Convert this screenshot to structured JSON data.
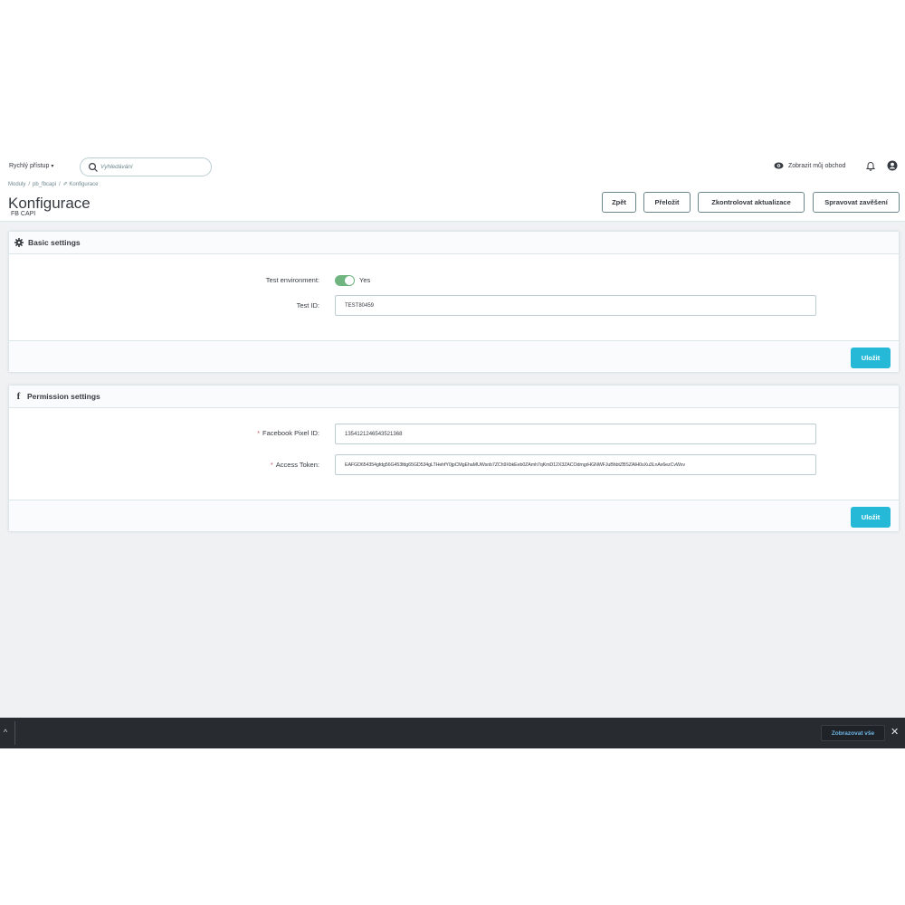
{
  "header": {
    "quick_access": "Rychlý přístup",
    "search_placeholder": "Vyhledávání",
    "view_shop": "Zobrazit můj obchod",
    "breadcrumb": [
      "Moduly",
      "pb_fbcapi",
      "Konfigurace"
    ],
    "title": "Konfigurace",
    "subtitle": "FB CAPI",
    "buttons": {
      "back": "Zpět",
      "translate": "Přeložit",
      "check_updates": "Zkontrolovat aktualizace",
      "manage_hooks": "Spravovat zavěšení"
    }
  },
  "basic_settings": {
    "title": "Basic settings",
    "test_env_label": "Test environment:",
    "test_env_value": "Yes",
    "test_id_label": "Test ID:",
    "test_id_value": "TEST80459",
    "save": "Uložit"
  },
  "permission_settings": {
    "title": "Permission settings",
    "required_mark": "*",
    "pixel_label": "Facebook Pixel ID:",
    "pixel_value": "1354121246543521368",
    "token_label": "Access Token:",
    "token_value": "EAFGD654354gfdg56G453fdg65GD534gLTHehfY0jpCMgEhaMUWsnb7ZCh9XbkEeb0ZAmh7qKmD12X3ZACOdmgrHGNWFJuBhbtZBSZAlH0sXu3LnAx6ezCvWxv",
    "save": "Uložit"
  },
  "bottom_bar": {
    "show_all": "Zobrazovat vše",
    "close": "✕",
    "expand": "^"
  },
  "colors": {
    "primary": "#25b9d7",
    "toggle_on": "#70b580",
    "required": "#c05c67",
    "background": "#eff1f2"
  }
}
